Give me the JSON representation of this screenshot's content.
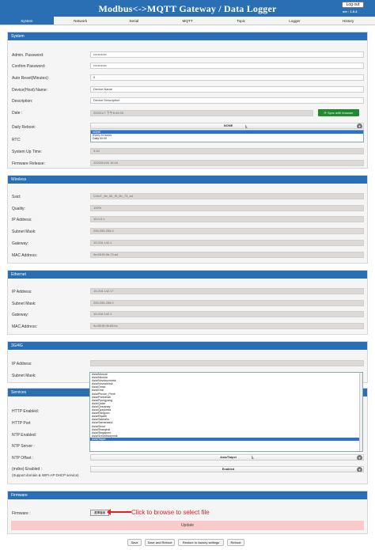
{
  "header": {
    "title": "Modbus<->MQTT Gateway / Data Logger",
    "logout_label": "Log out",
    "version": "ver : 1.0.4",
    "color": "#2a6fb4"
  },
  "tabs": [
    "System",
    "Network",
    "Serial",
    "MQTT",
    "Topic",
    "Logger",
    "History"
  ],
  "system": {
    "title": "System",
    "admin_password_label": "Admin. Password:",
    "admin_password_value": "••••••••••••",
    "confirm_password_label": "Confirm Password:",
    "confirm_password_value": "••••••••••••",
    "auto_reset_label": "Auto Reset(Minutes):",
    "auto_reset_value": "0",
    "device_name_label": "Device(Host) Name:",
    "device_name_value": "Device Name",
    "description_label": "Description:",
    "description_value": "Device Description",
    "date_label": "Date :",
    "date_value": "2023/1/7 下午8:45:03",
    "sync_label": "Sync with browser",
    "daily_reboot_label": "Daily Reboot:",
    "daily_reboot_value": "NONE",
    "daily_reboot_options": [
      "NONE",
      "Every 24 hours",
      "Daily 00:00"
    ],
    "rtc_label": "RTC:",
    "uptime_label": "System Up Time:",
    "uptime_value": "3:43",
    "firmware_label": "Firmware Release:",
    "firmware_value": "2023/01/04 16:16"
  },
  "wireless": {
    "title": "Wireless",
    "ssid_label": "Ssid:",
    "ssid_value": "CVioT_9e_65_f9_0b_73_a4",
    "quality_label": "Quality:",
    "quality_value": "100%",
    "ip_label": "IP Address:",
    "ip_value": "15.0.0.1",
    "mask_label": "Subnet Mask:",
    "mask_value": "255.255.255.0",
    "gateway_label": "Gateway:",
    "gateway_value": "15.216.142.1",
    "mac_label": "MAC Address:",
    "mac_value": "9e:65:f9:0b:73:a4"
  },
  "ethernet": {
    "title": "Ethernet",
    "ip_label": "IP Address:",
    "ip_value": "15.216.142.17",
    "mask_label": "Subnet Mask:",
    "mask_value": "255.255.255.0",
    "gateway_label": "Gateway:",
    "gateway_value": "15.216.142.1",
    "mac_label": "MAC Address:",
    "mac_value": "9c:65:f9:0b:65:bc"
  },
  "cellular": {
    "title": "3G/4G",
    "ip_label": "IP Address:",
    "mask_label": "Subnet Mask:"
  },
  "timezone_list": [
    "Asia/Muscat",
    "Asia/Nicosia",
    "Asia/Novokuznetsk",
    "Asia/Novosibirsk",
    "Asia/Omsk",
    "Asia/Oral",
    "Asia/Phnom_Penh",
    "Asia/Pontianak",
    "Asia/Pyongyang",
    "Asia/Qatar",
    "Asia/Qostanay",
    "Asia/Qyzylorda",
    "Asia/Rangoon",
    "Asia/Riyadh",
    "Asia/Sakhalin",
    "Asia/Samarkand",
    "Asia/Seoul",
    "Asia/Shanghai",
    "Asia/Singapore",
    "Asia/Srednekolymsk",
    "Asia/Taipei"
  ],
  "services": {
    "title": "Services",
    "http_enabled_label": "HTTP Enabled:",
    "http_port_label": "HTTP Port",
    "ntp_enabled_label": "NTP Enabled:",
    "ntp_server_label": "NTP Server :",
    "ntp_offset_label": "NTP Offset :",
    "ntp_offset_value": "Asia/Taipei",
    "mdns_label": "(mdns) Enabled :",
    "mdns_sub": "(Support domain & WIFI-AP DHCP service)",
    "mdns_value": "Enabled"
  },
  "firmware": {
    "title": "Firmware",
    "file_label": "Firmware :",
    "browse_label": "選擇檔案",
    "annotation": "Click to browse to select file",
    "update_label": "Update"
  },
  "footer": {
    "save": "Save",
    "save_reboot": "Save and Reboot",
    "restore": "Restore to factory settings",
    "reboot": "Reboot"
  }
}
